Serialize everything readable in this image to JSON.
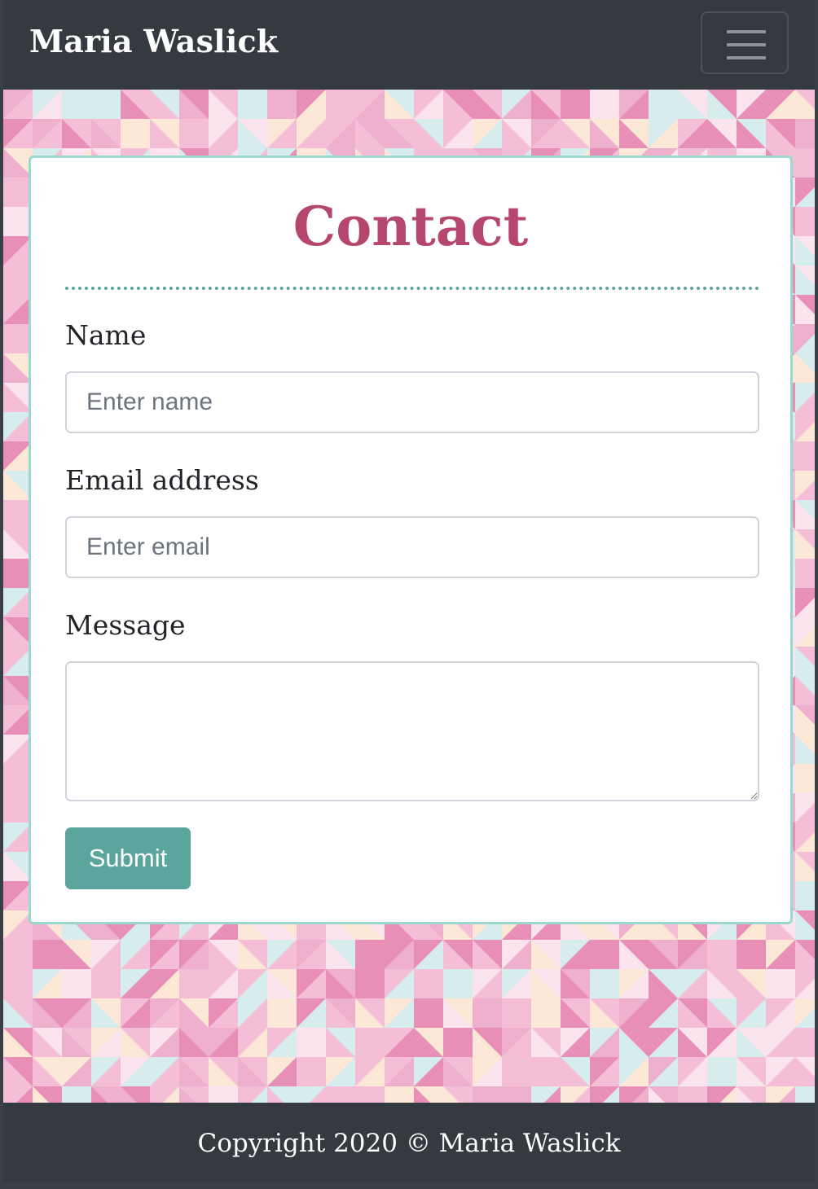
{
  "navbar": {
    "brand": "Maria Waslick",
    "toggler_icon": "hamburger-menu-icon"
  },
  "contact": {
    "title": "Contact",
    "name_label": "Name",
    "name_placeholder": "Enter name",
    "name_value": "",
    "email_label": "Email address",
    "email_placeholder": "Enter email",
    "email_value": "",
    "message_label": "Message",
    "message_value": "",
    "submit_label": "Submit"
  },
  "footer": {
    "text": "Copyright 2020 © Maria Waslick"
  },
  "colors": {
    "navbar_bg": "#343a40",
    "title": "#b5466f",
    "accent_teal": "#5aa69d",
    "card_border": "#9ad8d0",
    "pattern": [
      "#f4bfd6",
      "#e88fb7",
      "#fbe4ee",
      "#d7ecec",
      "#fde7d6",
      "#eeb0cc"
    ]
  }
}
